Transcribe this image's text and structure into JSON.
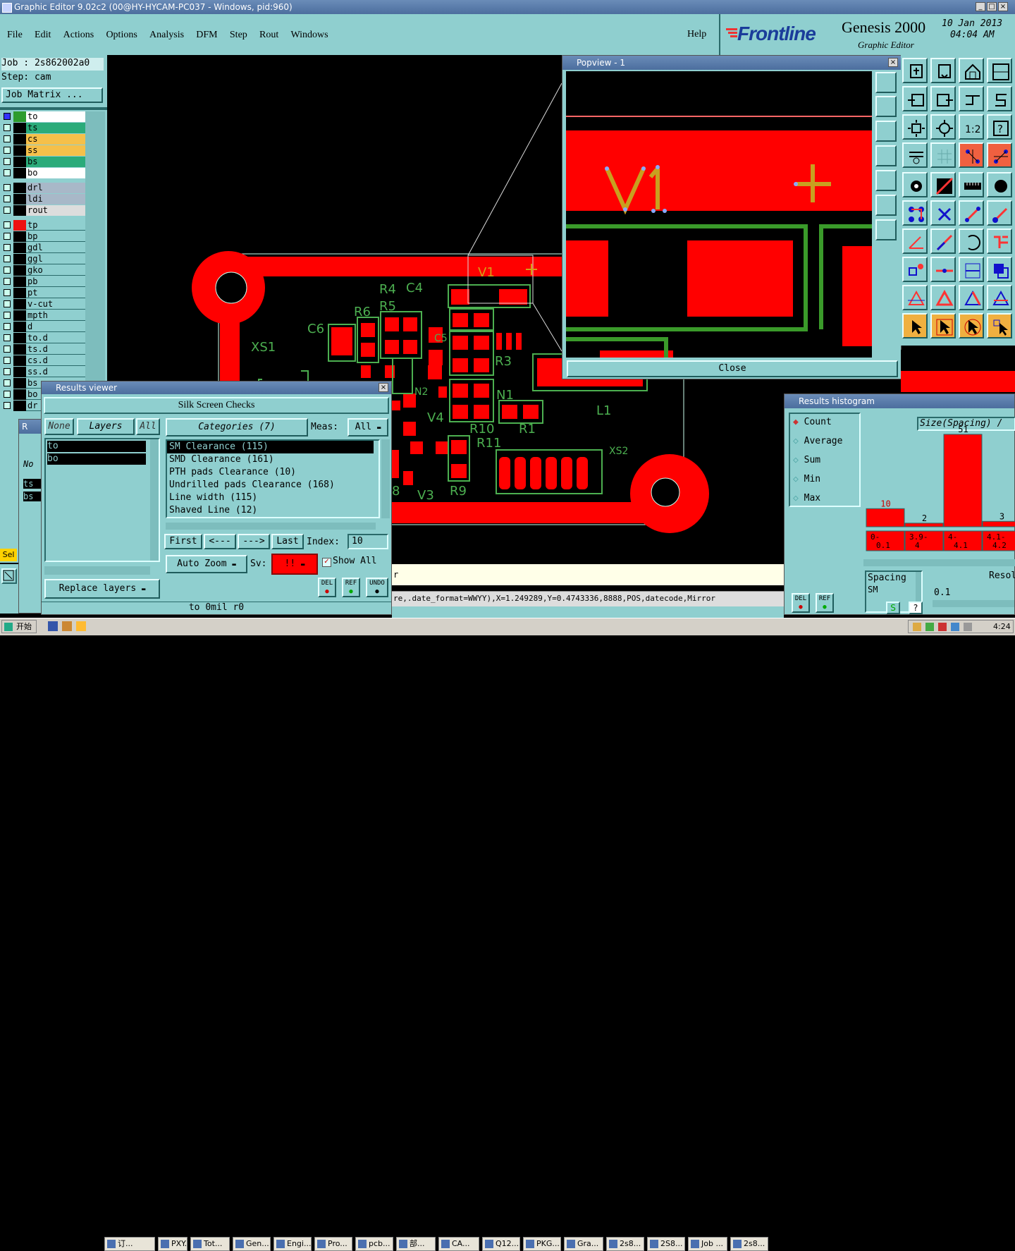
{
  "window": {
    "title": "Graphic Editor 9.02c2 (00@HY-HYCAM-PC037 - Windows, pid:960)"
  },
  "menu": {
    "items": [
      "File",
      "Edit",
      "Actions",
      "Options",
      "Analysis",
      "DFM",
      "Step",
      "Rout",
      "Windows"
    ],
    "help": "Help"
  },
  "brand": {
    "logo": "Frontline",
    "product": "Genesis 2000",
    "subtitle": "Graphic Editor",
    "date": "10 Jan 2013",
    "time": "04:04 AM"
  },
  "job": {
    "job_label": "Job : 2s862002a0",
    "step_label": "Step: cam",
    "matrix_button": "Job Matrix ..."
  },
  "layers": {
    "group1": [
      "to",
      "ts",
      "cs",
      "ss",
      "bs",
      "bo"
    ],
    "group2": [
      "drl",
      "ldi",
      "rout"
    ],
    "group3": [
      "tp",
      "bp",
      "gdl",
      "ggl",
      "gko",
      "pb",
      "pt",
      "v-cut",
      "mpth",
      "d",
      "to.d",
      "ts.d",
      "cs.d",
      "ss.d",
      "bs",
      "bo",
      "dr"
    ]
  },
  "left_bottom": {
    "sel": "Sel",
    "mini_no": "No",
    "mini_ts": "ts",
    "mini_bs": "bs"
  },
  "canvas": {
    "refdes": [
      "R4",
      "C4",
      "R6",
      "R5",
      "C6",
      "XS1",
      "C5",
      "R3",
      "N2",
      "N1",
      "V4",
      "R10",
      "R1",
      "R11",
      "L1",
      "XS2",
      "V3",
      "R9",
      "V1",
      "8"
    ]
  },
  "popview": {
    "title": "Popview - 1",
    "close": "Close",
    "label": "V1"
  },
  "results_viewer": {
    "title": "Results viewer",
    "heading": "Silk Screen Checks",
    "none": "None",
    "layers": "Layers",
    "all": "All",
    "layer_items": [
      "to",
      "bo"
    ],
    "categories_label": "Categories (7)",
    "meas_label": "Meas:",
    "meas_value": "All",
    "categories": [
      "SM Clearance (115)",
      "SMD Clearance (161)",
      "PTH pads Clearance (10)",
      "Undrilled pads Clearance (168)",
      "Line width (115)",
      "Shaved Line (12)"
    ],
    "first": "First",
    "prev": "<---",
    "next": "--->",
    "last": "Last",
    "index_label": "Index:",
    "index_value": "10",
    "auto_zoom": "Auto Zoom",
    "sv_label": "Sv:",
    "sv_value": "!!",
    "show_all": "Show All",
    "replace_layers": "Replace layers",
    "del": "DEL",
    "ref": "REF",
    "undo": "UNDO",
    "status": "to 0mil  r0"
  },
  "status_line": {
    "text": "re,.date_format=WWYY),X=1.249289,Y=0.4743336,8888,POS,datecode,Mirror",
    "partial": "r"
  },
  "histogram": {
    "title": "Results histogram",
    "options": [
      "Count",
      "Average",
      "Sum",
      "Min",
      "Max"
    ],
    "selected": "Count",
    "heading": "Size(Spacing) /",
    "del": "DEL",
    "ref": "REF",
    "info_label": "Spacing",
    "info_sub": "SM",
    "resol_label": "Resol",
    "resol_value": "0.1"
  },
  "chart_data": {
    "type": "bar",
    "title": "Size(Spacing) /",
    "categories": [
      "0-0.1",
      "3.9-4",
      "4-4.1",
      "4.1-4.2"
    ],
    "values": [
      10,
      2,
      51,
      3
    ],
    "color": "#ff0000"
  },
  "taskbar": {
    "start": "开始",
    "items": [
      "订...",
      "PXY...",
      "Tot...",
      "Gen...",
      "Engi...",
      "Pro...",
      "pcb...",
      "部...",
      "CA...",
      "Q12...",
      "PKG...",
      "Gra...",
      "2s8...",
      "2S8...",
      "Job ...",
      "2s8..."
    ],
    "clock": "4:24"
  },
  "colors": {
    "teal": "#8fcfcf",
    "copper": "#ff0000",
    "silk": "#4caf50",
    "panel_dark": "#2a6a6a"
  }
}
